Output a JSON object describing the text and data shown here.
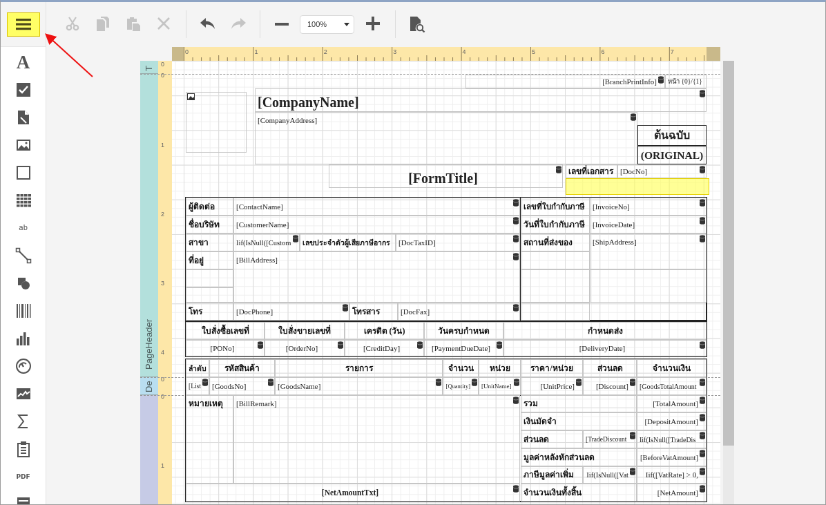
{
  "toolbar": {
    "menu": {
      "highlighted": true
    },
    "items": [
      {
        "kind": "cut",
        "disabled": true
      },
      {
        "kind": "copy",
        "disabled": true
      },
      {
        "kind": "paste",
        "disabled": true
      },
      {
        "kind": "delete",
        "disabled": true
      },
      {
        "kind": "undo",
        "disabled": false
      },
      {
        "kind": "redo",
        "disabled": true
      },
      {
        "kind": "zoom-out",
        "disabled": false
      },
      {
        "kind": "zoom",
        "value": "100%"
      },
      {
        "kind": "zoom-in",
        "disabled": false
      },
      {
        "kind": "preview",
        "disabled": false
      }
    ]
  },
  "toolbox": [
    {
      "kind": "label",
      "glyph": "A"
    },
    {
      "kind": "checkbox"
    },
    {
      "kind": "richtext"
    },
    {
      "kind": "picture"
    },
    {
      "kind": "panel"
    },
    {
      "kind": "table"
    },
    {
      "kind": "character",
      "glyph": "ab"
    },
    {
      "kind": "line"
    },
    {
      "kind": "shape"
    },
    {
      "kind": "barcode"
    },
    {
      "kind": "chart"
    },
    {
      "kind": "gauge"
    },
    {
      "kind": "sparkline"
    },
    {
      "kind": "summary"
    },
    {
      "kind": "pageinfo"
    },
    {
      "kind": "pdf",
      "glyph": "PDF"
    },
    {
      "kind": "subreport"
    }
  ],
  "ruler": {
    "horizontal": [
      "0",
      "1",
      "2",
      "3",
      "4",
      "5",
      "6",
      "7"
    ],
    "vertical": [
      "0",
      "0",
      "1",
      "2",
      "3",
      "4",
      "0",
      "0",
      "1"
    ]
  },
  "bands": [
    {
      "kind": "margin",
      "label": "T"
    },
    {
      "kind": "header",
      "label": "PageHeader"
    },
    {
      "kind": "detail",
      "label": "De"
    },
    {
      "kind": "footer"
    }
  ],
  "highlight_box": true,
  "annotation_arrow": true,
  "controls": [
    {
      "text": "[BranchPrintInfo]",
      "kind": "field",
      "bound": true
    },
    {
      "text": "หน้า {0}/{1}",
      "kind": "field",
      "bound": false
    },
    {
      "kind": "image"
    },
    {
      "text": "[CompanyName]",
      "kind": "title",
      "bound": true
    },
    {
      "text": "[CompanyAddress]",
      "kind": "field",
      "bound": true
    },
    {
      "text": "ต้นฉบับ",
      "kind": "heading",
      "bound": false
    },
    {
      "text": "(ORIGINAL)",
      "kind": "heading",
      "bound": false
    },
    {
      "text": "[FormTitle]",
      "kind": "title",
      "bound": true
    },
    {
      "text": "เลขที่เอกสาร",
      "kind": "label",
      "bound": false
    },
    {
      "text": "[DocNo]",
      "kind": "field",
      "bound": true
    },
    {
      "text": "ผู้ติดต่อ",
      "kind": "label",
      "bound": false
    },
    {
      "text": "[ContactName]",
      "kind": "field",
      "bound": true
    },
    {
      "text": "ชื่อบริษัท",
      "kind": "label",
      "bound": false
    },
    {
      "text": "[CustomerName]",
      "kind": "field",
      "bound": true
    },
    {
      "text": "สาขา",
      "kind": "label",
      "bound": false
    },
    {
      "text": "Iif(IsNull([Custom",
      "kind": "field",
      "bound": true
    },
    {
      "text": "เลขประจำตัวผู้เสียภาษีอากร",
      "kind": "label",
      "bound": false
    },
    {
      "text": "[DocTaxID]",
      "kind": "field",
      "bound": true
    },
    {
      "text": "ที่อยู่",
      "kind": "label",
      "bound": false
    },
    {
      "text": "[BillAddress]",
      "kind": "field",
      "bound": true
    },
    {
      "text": "โทร",
      "kind": "label",
      "bound": false
    },
    {
      "text": "[DocPhone]",
      "kind": "field",
      "bound": true
    },
    {
      "text": "โทรสาร",
      "kind": "label",
      "bound": false
    },
    {
      "text": "[DocFax]",
      "kind": "field",
      "bound": true
    },
    {
      "text": "เลขที่ใบกำกับภาษี",
      "kind": "label",
      "bound": false
    },
    {
      "text": "[InvoiceNo]",
      "kind": "field",
      "bound": true
    },
    {
      "text": "วันที่ใบกำกับภาษี",
      "kind": "label",
      "bound": false
    },
    {
      "text": "[InvoiceDate]",
      "kind": "field",
      "bound": true
    },
    {
      "text": "สถานที่ส่งของ",
      "kind": "label",
      "bound": false
    },
    {
      "text": "[ShipAddress]",
      "kind": "field",
      "bound": true
    },
    {
      "text": "ใบสั่งซื้อเลขที่",
      "kind": "label",
      "bound": false
    },
    {
      "text": "ใบสั่งขายเลขที่",
      "kind": "label",
      "bound": false
    },
    {
      "text": "เครดิต (วัน)",
      "kind": "label",
      "bound": false
    },
    {
      "text": "วันครบกำหนด",
      "kind": "label",
      "bound": false
    },
    {
      "text": "กำหนดส่ง",
      "kind": "label",
      "bound": false
    },
    {
      "text": "[PONo]",
      "kind": "field",
      "bound": true
    },
    {
      "text": "[OrderNo]",
      "kind": "field",
      "bound": true
    },
    {
      "text": "[CreditDay]",
      "kind": "field",
      "bound": true
    },
    {
      "text": "[PaymentDueDate]",
      "kind": "field",
      "bound": true
    },
    {
      "text": "[DeliveryDate]",
      "kind": "field",
      "bound": true
    },
    {
      "text": "ลำดับ",
      "kind": "label",
      "bound": false
    },
    {
      "text": "รหัสสินค้า",
      "kind": "label",
      "bound": false
    },
    {
      "text": "รายการ",
      "kind": "label",
      "bound": false
    },
    {
      "text": "จำนวน",
      "kind": "label",
      "bound": false
    },
    {
      "text": "หน่วย",
      "kind": "label",
      "bound": false
    },
    {
      "text": "ราคา/หน่วย",
      "kind": "label",
      "bound": false
    },
    {
      "text": "ส่วนลด",
      "kind": "label",
      "bound": false
    },
    {
      "text": "จำนวนเงิน",
      "kind": "label",
      "bound": false
    },
    {
      "text": "[List",
      "kind": "field",
      "bound": true
    },
    {
      "text": "[GoodsNo]",
      "kind": "field",
      "bound": true
    },
    {
      "text": "[GoodsName]",
      "kind": "field",
      "bound": true
    },
    {
      "text": "[Quantity]",
      "kind": "field",
      "bound": true
    },
    {
      "text": "[UnitName]",
      "kind": "field",
      "bound": true
    },
    {
      "text": "[UnitPrice]",
      "kind": "field",
      "bound": true
    },
    {
      "text": "[Discount]",
      "kind": "field",
      "bound": true
    },
    {
      "text": "[GoodsTotalAmount",
      "kind": "field",
      "bound": true
    },
    {
      "text": "หมายเหตุ",
      "kind": "label",
      "bound": false
    },
    {
      "text": "[BillRemark]",
      "kind": "field",
      "bound": true
    },
    {
      "text": "[NetAmountTxt]",
      "kind": "total",
      "bound": true
    },
    {
      "text": "รวม",
      "kind": "label",
      "bound": false
    },
    {
      "text": "[TotalAmount]",
      "kind": "field",
      "bound": true
    },
    {
      "text": "เงินมัดจำ",
      "kind": "label",
      "bound": false
    },
    {
      "text": "[DepositAmount]",
      "kind": "field",
      "bound": true
    },
    {
      "text": "ส่วนลด",
      "kind": "label",
      "bound": false
    },
    {
      "text": "[TradeDiscount",
      "kind": "field",
      "bound": true
    },
    {
      "text": "Iif(IsNull([TradeDis",
      "kind": "field",
      "bound": true
    },
    {
      "text": "มูลค่าหลังหักส่วนลด",
      "kind": "label",
      "bound": false
    },
    {
      "text": "[BeforeVatAmount]",
      "kind": "field",
      "bound": true
    },
    {
      "text": "ภาษีมูลค่าเพิ่ม",
      "kind": "label",
      "bound": false
    },
    {
      "text": "Iif(IsNull([Vat",
      "kind": "field",
      "bound": true
    },
    {
      "text": "Iif([VatRate] > 0,",
      "kind": "field",
      "bound": true
    },
    {
      "text": "จำนวนเงินทั้งสิ้น",
      "kind": "label",
      "bound": false
    },
    {
      "text": "[NetAmount]",
      "kind": "field",
      "bound": true
    }
  ]
}
